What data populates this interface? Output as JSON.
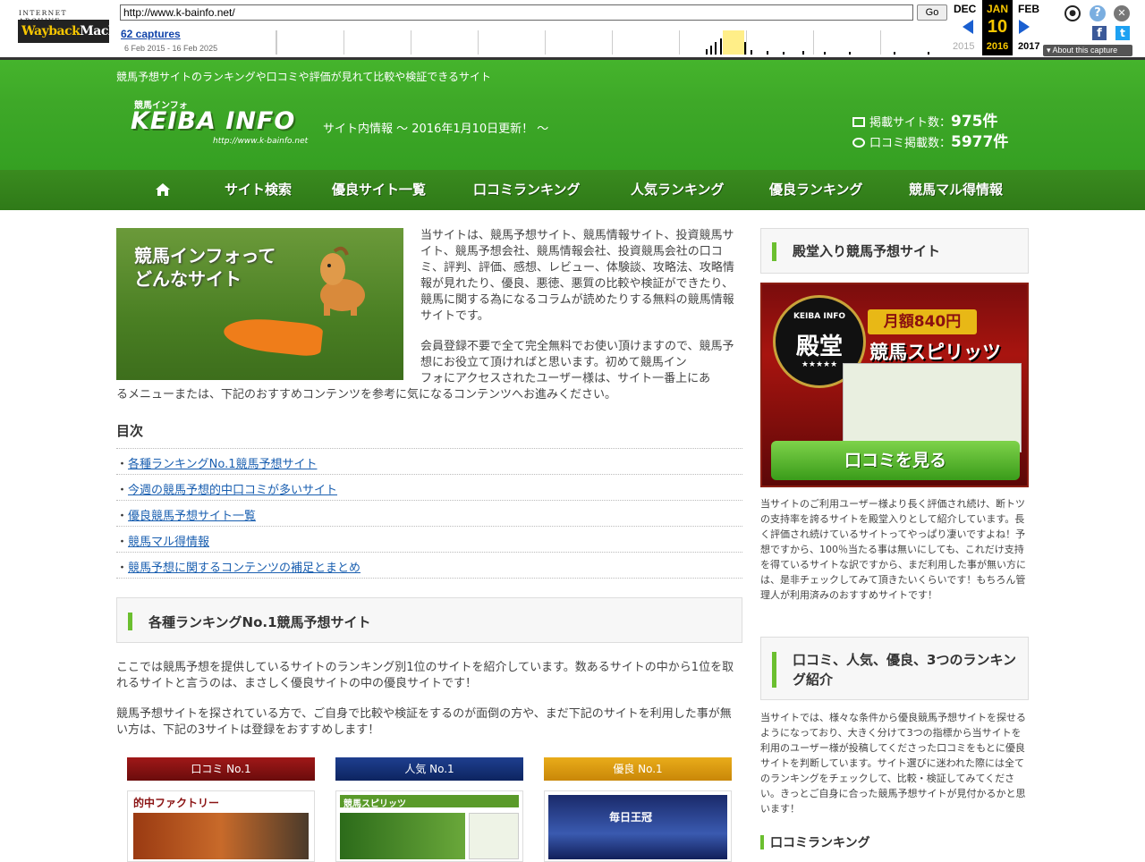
{
  "wayback": {
    "logo_top": "INTERNET ARCHIVE",
    "logo_main_a": "Wayback",
    "logo_main_b": "Machine",
    "url": "http://www.k-bainfo.net/",
    "go_label": "Go",
    "captures": "62 captures",
    "range": "6 Feb 2015 - 16 Feb 2025",
    "prev_month": "DEC",
    "prev_year": "2015",
    "cur_month": "JAN",
    "cur_day": "10",
    "cur_year": "2016",
    "next_month": "FEB",
    "next_year": "2017",
    "about": "About this capture",
    "help_glyph": "?",
    "close_glyph": "✕",
    "user_glyph": "●",
    "fb_glyph": "f",
    "tw_glyph": "t"
  },
  "header": {
    "tagline": "競馬予想サイトのランキングや口コミや評価が見れて比較や検証できるサイト",
    "logo_small": "競馬インフォ",
    "logo_main": "KEIBA INFO",
    "logo_url": "http://www.k-bainfo.net",
    "update": "サイト内情報 〜 2016年1月10日更新！ 〜",
    "sites_label": "掲載サイト数：",
    "sites_value": "975件",
    "reviews_label": "口コミ掲載数：",
    "reviews_value": "5977件"
  },
  "nav": {
    "items": [
      "サイト検索",
      "優良サイト一覧",
      "口コミランキング",
      "人気ランキング",
      "優良ランキング",
      "競馬マル得情報"
    ]
  },
  "main": {
    "intro_image_text_1": "競馬インフォって",
    "intro_image_text_2": "どんなサイト",
    "intro_p1": "当サイトは、競馬予想サイト、競馬情報サイト、投資競馬サイト、競馬予想会社、競馬情報会社、投資競馬会社の口コミ、評判、評価、感想、レビュー、体験談、攻略法、攻略情報が見れたり、優良、悪徳、悪質の比較や検証ができたり、競馬に関する為になるコラムが読めたりする無料の競馬情報サイトです。",
    "intro_p2a": "会員登録不要で全て完全無料でお使い頂けますので、競馬予想にお役立て頂ければと思います。初めて競馬イン",
    "intro_p2b": "フォにアクセスされたユーザー様は、サイト一番上にあ",
    "intro_p2c": "るメニューまたは、下記のおすすめコンテンツを参考に気になるコンテンツへお進みください。",
    "toc_title": "目次",
    "toc": [
      "各種ランキングNo.1競馬予想サイト",
      "今週の競馬予想的中口コミが多いサイト",
      "優良競馬予想サイト一覧",
      "競馬マル得情報",
      "競馬予想に関するコンテンツの補足とまとめ"
    ],
    "section_title": "各種ランキングNo.1競馬予想サイト",
    "section_p1": "ここでは競馬予想を提供しているサイトのランキング別1位のサイトを紹介しています。数あるサイトの中から1位を取れるサイトと言うのは、まさしく優良サイトの中の優良サイトです！",
    "section_p2": "競馬予想サイトを探されている方で、ご自身で比較や検証をするのが面倒の方や、まだ下記のサイトを利用した事が無い方は、下記の3サイトは登録をおすすめします！",
    "ranks": [
      {
        "label": "口コミ No.1",
        "color": "#8b1414"
      },
      {
        "label": "人気 No.1",
        "color": "#12327a"
      },
      {
        "label": "優良 No.1",
        "color": "#d99a0c"
      }
    ],
    "shot1_title": "的中ファクトリー",
    "shot2_title": "競馬スピリッツ",
    "shot3_title": "毎日王冠"
  },
  "side": {
    "hof_title": "殿堂入り競馬予想サイト",
    "hof_badge_top": "KEIBA INFO",
    "hof_badge_main": "殿堂",
    "hof_badge_stars": "★★★★★",
    "hof_price": "月額840円",
    "hof_name": "競馬スピリッツ",
    "hof_button": "口コミを見る",
    "hof_text": "当サイトのご利用ユーザー様より長く評価され続け、断トツの支持率を誇るサイトを殿堂入りとして紹介しています。長く評価され続けているサイトってやっぱり凄いですよね！予想ですから、100％当たる事は無いにしても、これだけ支持を得ているサイトな訳ですから、まだ利用した事が無い方には、是非チェックしてみて頂きたいくらいです！もちろん管理人が利用済みのおすすめサイトです！",
    "rank_title": "口コミ、人気、優良、3つのランキング紹介",
    "rank_text": "当サイトでは、様々な条件から優良競馬予想サイトを探せるようになっており、大きく分けて3つの指標から当サイトを利用のユーザー様が投稿してくださった口コミをもとに優良サイトを判断しています。サイト選びに迷われた際には全てのランキングをチェックして、比較・検証してみてください。きっとご自身に合った競馬予想サイトが見付かるかと思います！",
    "mini_title": "口コミランキング"
  }
}
